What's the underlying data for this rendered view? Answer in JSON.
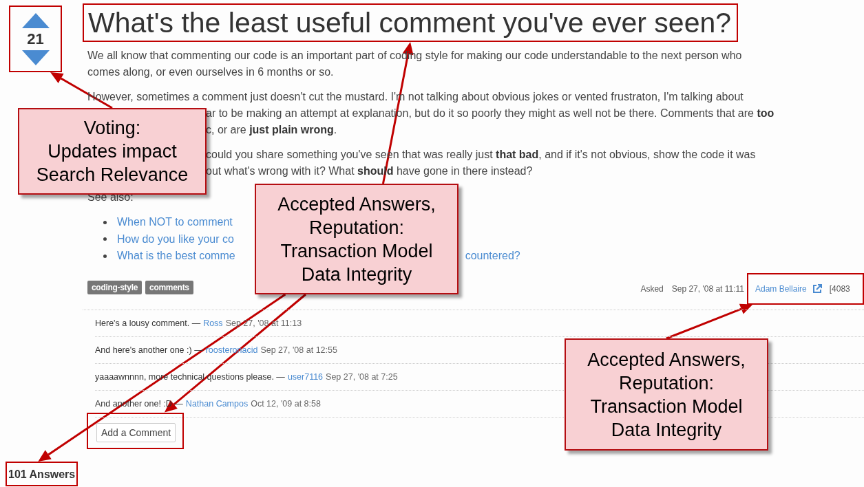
{
  "vote": {
    "count": "21",
    "highlighted": true
  },
  "question": {
    "title": {
      "text": "What's the least useful comment you've ever seen?",
      "highlighted": true
    },
    "paragraphs": [
      {
        "lines": [
          {
            "text": "We all know that commenting our code is an important part of coding style for making our code understandable to the next person who",
            "covered_start": false
          },
          {
            "text": "comes along, or even ourselves in 6 months or so.",
            "covered_start": false
          }
        ]
      },
      {
        "lines": [
          {
            "text": "However, sometimes a comment just doesn't cut the mustard. I'm not talking about obvious jokes or vented frustraton, I'm talking about",
            "covered_start": false
          },
          {
            "text": "ar to be making an attempt at explanation, but do it so poorly they might as well not be there. Comments that are **too**",
            "covered_start": true
          },
          {
            "text": "c, or are **just plain wrong**.",
            "covered_start": true
          }
        ]
      },
      {
        "lines": [
          {
            "text": "could you share something you've seen that was really just **that bad**, and if it's not obvious, show the code it was",
            "covered_start": true
          },
          {
            "text": "out what's wrong with it? What **should** have gone in there instead?",
            "covered_start": true
          }
        ]
      }
    ],
    "see_also": {
      "label": "See also:",
      "links": [
        {
          "fragments": [
            "When NOT to comment"
          ]
        },
        {
          "fragments": [
            "How do you like your co"
          ]
        },
        {
          "fragments": [
            "What is the best comme",
            "countered?"
          ]
        }
      ]
    },
    "tags": [
      "coding-style",
      "comments"
    ],
    "asked": {
      "label": "Asked",
      "date": "Sep 27, '08 at 11:11",
      "user": "Adam Bellaire",
      "reputation": "[4083",
      "highlighted": true
    }
  },
  "comments": [
    {
      "text": "Here's a lousy comment. —",
      "user": "Ross",
      "date": "Sep 27, '08 at 11:13"
    },
    {
      "text": "And here's another one :) —",
      "user": "roosteronacid",
      "date": "Sep 27, '08 at 12:55"
    },
    {
      "text": "yaaaawnnnn, more technical questions please. —",
      "user": "user7116",
      "date": "Sep 27, '08 at 7:25"
    },
    {
      "text": "And another one! :D —",
      "user": "Nathan Campos",
      "date": "Oct 12, '09 at 8:58"
    }
  ],
  "add_comment": {
    "label": "Add a Comment",
    "highlighted": true
  },
  "answers": {
    "text": "101 Answers",
    "highlighted": true
  },
  "callouts": [
    {
      "lines": [
        "Voting:",
        "Updates impact",
        "Search Relevance"
      ]
    },
    {
      "lines": [
        "Accepted Answers,",
        "Reputation:",
        "Transaction Model",
        "Data Integrity"
      ]
    },
    {
      "lines": [
        "Accepted Answers,",
        "Reputation:",
        "Transaction Model",
        "Data Integrity"
      ]
    }
  ]
}
